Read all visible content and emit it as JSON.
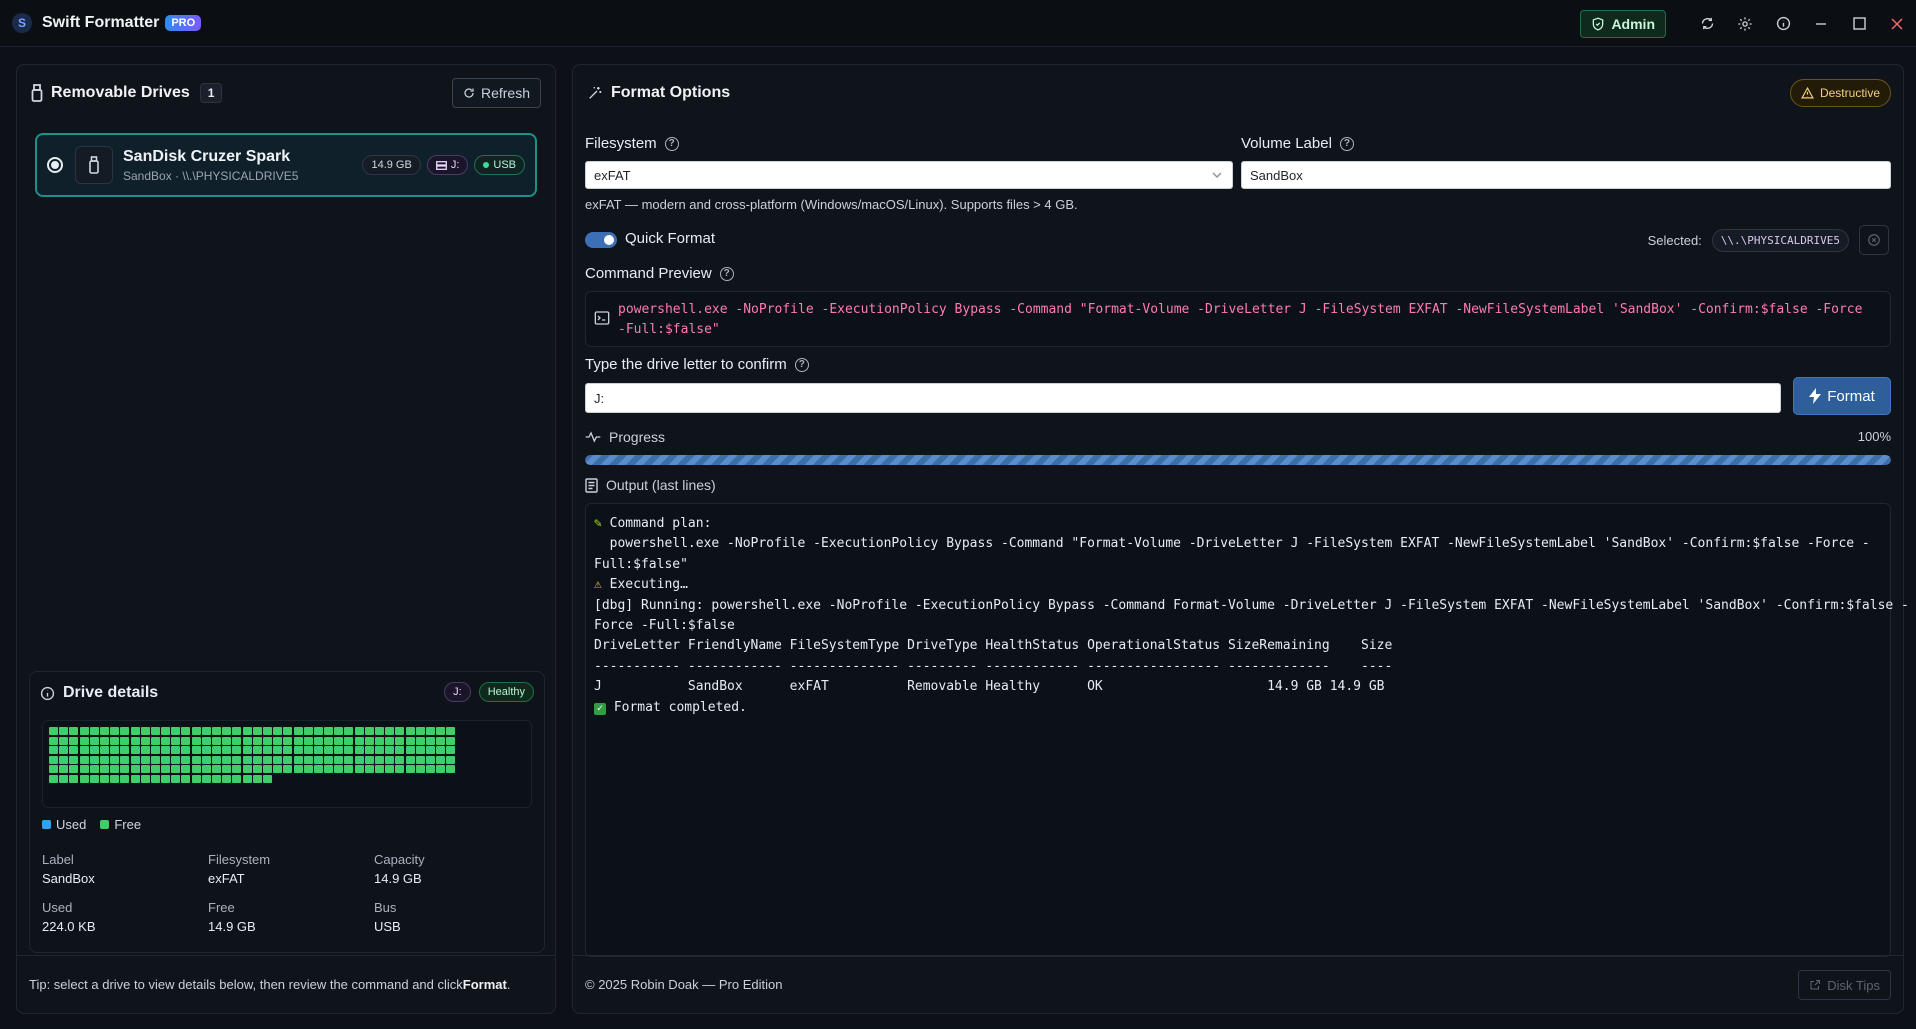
{
  "app": {
    "title": "Swift Formatter",
    "badge": "PRO"
  },
  "titlebar": {
    "admin_label": "Admin",
    "icons": [
      "sync-icon",
      "gear-icon",
      "info-icon"
    ],
    "window_controls": [
      "minimize",
      "maximize",
      "close"
    ]
  },
  "left": {
    "title": "Removable Drives",
    "count": "1",
    "refresh_label": "Refresh",
    "drive": {
      "name": "SanDisk Cruzer Spark",
      "sub": "SandBox · \\\\.\\PHYSICALDRIVE5",
      "size": "14.9 GB",
      "letter": "J:",
      "bus": "USB",
      "selected": true
    },
    "details": {
      "title": "Drive details",
      "letter": "J:",
      "health": "Healthy",
      "legend_used": "Used",
      "legend_free": "Free",
      "used_color": "#2ea3f2",
      "free_color": "#3ecf6a",
      "used_fraction": 1e-05,
      "stats": [
        {
          "label": "Label",
          "value": "SandBox"
        },
        {
          "label": "Filesystem",
          "value": "exFAT"
        },
        {
          "label": "Capacity",
          "value": "14.9 GB"
        },
        {
          "label": "Used",
          "value": "224.0 KB"
        },
        {
          "label": "Free",
          "value": "14.9 GB"
        },
        {
          "label": "Bus",
          "value": "USB"
        }
      ]
    },
    "tip_prefix": "Tip: select a drive to view details below, then review the command and click ",
    "tip_bold": "Format",
    "tip_suffix": "."
  },
  "right": {
    "title": "Format Options",
    "destructive": "Destructive",
    "filesystem_label": "Filesystem",
    "filesystem_value": "exFAT",
    "filesystem_hint": "exFAT — modern and cross-platform (Windows/macOS/Linux). Supports files > 4 GB.",
    "volume_label_label": "Volume Label",
    "volume_label_value": "SandBox",
    "quick_format_label": "Quick Format",
    "quick_format_on": true,
    "selected_label": "Selected:",
    "selected_value": "\\\\.\\PHYSICALDRIVE5",
    "command_preview_label": "Command Preview",
    "command_preview": "powershell.exe -NoProfile -ExecutionPolicy Bypass -Command \"Format-Volume -DriveLetter J -FileSystem EXFAT -NewFileSystemLabel 'SandBox' -Confirm:$false -Force -Full:$false\"",
    "confirm_label": "Type the drive letter to confirm",
    "confirm_value": "J:",
    "format_button": "Format",
    "progress_label": "Progress",
    "progress_percent": "100%",
    "progress_value": 1.0,
    "output_label": "Output (last lines)",
    "output_lines": [
      " Command plan:",
      "  powershell.exe -NoProfile -ExecutionPolicy Bypass -Command \"Format-Volume -DriveLetter J -FileSystem EXFAT -NewFileSystemLabel 'SandBox' -Confirm:$false -Force -",
      "Full:$false\"",
      "",
      " Executing…",
      "[dbg] Running: powershell.exe -NoProfile -ExecutionPolicy Bypass -Command Format-Volume -DriveLetter J -FileSystem EXFAT -NewFileSystemLabel 'SandBox' -Confirm:$false -",
      "Force -Full:$false",
      "",
      "DriveLetter FriendlyName FileSystemType DriveType HealthStatus OperationalStatus SizeRemaining    Size",
      "----------- ------------ -------------- --------- ------------ ----------------- -------------    ----",
      "J           SandBox      exFAT          Removable Healthy      OK                     14.9 GB 14.9 GB",
      "",
      "",
      "",
      " Format completed."
    ],
    "footer": "© 2025 Robin Doak — Pro Edition",
    "disk_tips": "Disk Tips"
  }
}
